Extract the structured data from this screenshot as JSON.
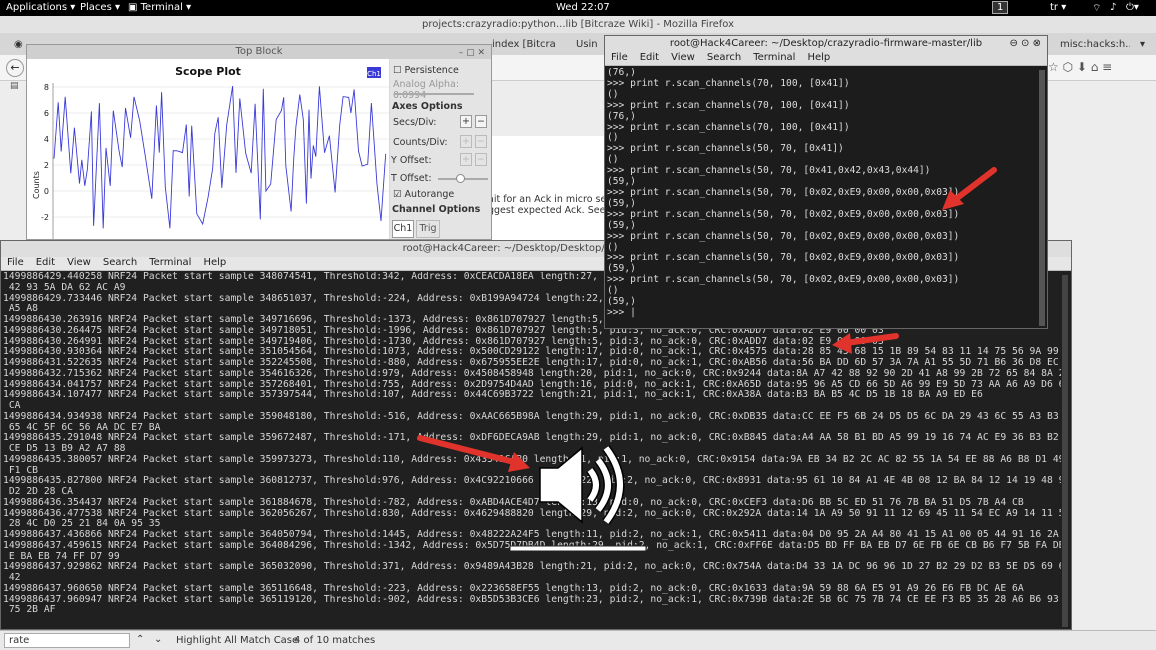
{
  "topbar": {
    "applications": "Applications ▾",
    "places": "Places ▾",
    "terminal": "Terminal ▾",
    "clock": "Wed 22:07",
    "workspace": "1",
    "lang": "tr ▾"
  },
  "firefox": {
    "title": "projects:crazyradio:python...lib [Bitcraze Wiki] - Mozilla Firefox",
    "tabs": [
      "index [Bitcra",
      "Usin",
      "misc:hacks:h..."
    ],
    "wiki_lines": [
      "ait for an Ack in micro second",
      "ggest expected Ack. See nRF"
    ]
  },
  "scope": {
    "window_title": "Top Block",
    "plot_title": "Scope Plot",
    "ch_label": "Ch1",
    "ylabel": "Counts",
    "yticks": [
      "8",
      "6",
      "4",
      "2",
      "0",
      "-2"
    ],
    "persistence": "Persistence",
    "analog_alpha": "Analog Alpha: 0.0994",
    "axes_options": "Axes Options",
    "secs_div": "Secs/Div:",
    "counts_div": "Counts/Div:",
    "y_offset": "Y Offset:",
    "t_offset": "T Offset:",
    "autorange": "Autorange",
    "channel_options": "Channel Options",
    "tab_ch1": "Ch1",
    "tab_trig": "Trig",
    "plus": "+",
    "minus": "−"
  },
  "term2": {
    "title": "root@Hack4Career: ~/Desktop/crazyradio-firmware-master/lib",
    "menu": [
      "File",
      "Edit",
      "View",
      "Search",
      "Terminal",
      "Help"
    ],
    "lines": [
      "(76,)",
      ">>> print r.scan_channels(70, 100, [0x41])",
      "()",
      ">>> print r.scan_channels(70, 100, [0x41])",
      "(76,)",
      ">>> print r.scan_channels(70, 100, [0x41])",
      "()",
      ">>> print r.scan_channels(50, 70, [0x41])",
      "()",
      ">>> print r.scan_channels(50, 70, [0x41,0x42,0x43,0x44])",
      "(59,)",
      ">>> print r.scan_channels(50, 70, [0x02,0xE9,0x00,0x00,0x03])",
      "(59,)",
      ">>> print r.scan_channels(50, 70, [0x02,0xE9,0x00,0x00,0x03])",
      "(59,)",
      ">>> print r.scan_channels(50, 70, [0x02,0xE9,0x00,0x00,0x03])",
      "()",
      ">>> print r.scan_channels(50, 70, [0x02,0xE9,0x00,0x00,0x03])",
      "(59,)",
      ">>> print r.scan_channels(50, 70, [0x02,0xE9,0x00,0x00,0x03])",
      "()",
      "(59,)",
      ">>> |"
    ]
  },
  "term1": {
    "title": "root@Hack4Career: ~/Desktop/Desktop/NRF24-BTLE-",
    "menu": [
      "File",
      "Edit",
      "View",
      "Search",
      "Terminal",
      "Help"
    ],
    "lines": [
      "1499886429.440258 NRF24 Packet start sample 348074541, Threshold:342, Address: 0xCEACDA18EA length:27, pid:1, no",
      " 42 93 5A DA 62 AC A9",
      "1499886429.733446 NRF24 Packet start sample 348651037, Threshold:-224, Address: 0xB199A94724 length:22, pid:3, no",
      " A5 A8",
      "1499886430.263916 NRF24 Packet start sample 349716696, Threshold:-1373, Address: 0x861D707927 length:5, pid:3, no_ack:0, CRC:0xADD7 data:02 E9 00 00 03",
      "1499886430.264475 NRF24 Packet start sample 349718051, Threshold:-1996, Address: 0x861D707927 length:5, pid:3, no_ack:0, CRC:0xADD7 data:02 E9 00 00 03",
      "1499886430.264991 NRF24 Packet start sample 349719406, Threshold:-1730, Address: 0x861D707927 length:5, pid:3, no_ack:0, CRC:0xADD7 data:02 E9 00 00 03",
      "1499886430.930364 NRF24 Packet start sample 351054564, Threshold:1073, Address: 0x500CD29122 length:17, pid:0, no_ack:1, CRC:0x4575 data:28 85 45 68 15 1B 89 54 83 11 14 75 56 9A 99 21",
      "1499886431.522635 NRF24 Packet start sample 352245508, Threshold:-880, Address: 0x675955EE2E length:17, pid:0, no_ack:1, CRC:0xAB56 data:56 BA DD 6D 57 3A 7A A1 55 5D 71 B6 36 D8 EC DF 7E",
      "1499886432.715362 NRF24 Packet start sample 354616326, Threshold:979, Address: 0x4508458948 length:20, pid:1, no_ack:0, CRC:0x9244 data:8A A7 42 88 92 90 2D 41 A8 99 2B 72 65 84 8A 2A 6E 48 8A 11",
      "1499886434.041757 NRF24 Packet start sample 357268401, Threshold:755, Address: 0x2D9754D4AD length:16, pid:0, no_ack:1, CRC:0xA65D data:95 96 A5 CD 66 5D A6 99 E9 5D 73 AA A6 A9 D6 6A",
      "1499886434.107477 NRF24 Packet start sample 357397544, Threshold:107, Address: 0x44C69B3722 length:21, pid:1, no_ack:1, CRC:0xA38A data:B3 BA B5 4C D5 1B 18 BA A9 ED E6",
      " CA",
      "1499886434.934938 NRF24 Packet start sample 359048180, Threshold:-516, Address: 0xAAC665B98A length:29, pid:1, no_ack:0, CRC:0xDB35 data:CC EE F5 6B 24 D5 D5 6C DA 29 43 6C 55 A3 B3 2D 99 D5 B3 BA",
      " 65 4C 5F 6C 56 AA DC E7 BA",
      "1499886435.291048 NRF24 Packet start sample 359672487, Threshold:-171, Address: 0xDF6DECA9AB length:29, pid:1, no_ack:0, CRC:0xB845 data:A4 AA 58 B1 BD A5 99 19 16 74 AC E9 36 B3 B2 BC AB 53 76 7D",
      " CE D5 13 B9 A2 A7 88",
      "1499886435.380057 NRF24 Packet start sample 359973273, Threshold:110, Address: 0x43541CAB0 length:21, pid:1, no_ack:0, CRC:0x9154 data:9A EB 34 B2 2C AC 82 55 1A 54 EE 88 A6 B8 D1 49 4E 94 E5 54",
      " F1 CB",
      "1499886435.827800 NRF24 Packet start sample 360812737, Threshold:976, Address: 0x4C92210666 length:22, pid:2, no_ack:0, CRC:0x8931 data:95 61 10 84 A1 4E 4B 08 12 BA 84 12 14 19 48 90 62 91 89 94",
      " D2 2D 28 CA",
      "1499886436.354437 NRF24 Packet start sample 361884678, Threshold:-782, Address: 0xABD4ACE4D7 length:13, pid:0, no_ack:0, CRC:0xCEF3 data:D6 BB 5C ED 51 76 7B BA 51 D5 7B A4 CB",
      "1499886436.477538 NRF24 Packet start sample 362056267, Threshold:830, Address: 0x4629488820 length:29, pid:2, no_ack:0, CRC:0x292A data:14 1A A9 50 91 11 12 69 45 11 54 EC A9 14 11 50 AC D5 15 41",
      " 28 4C D0 25 21 84 0A 95 35",
      "1499886437.436866 NRF24 Packet start sample 364050794, Threshold:1445, Address: 0x48222A24F5 length:11, pid:2, no_ack:1, CRC:0x5411 data:04 D0 95 2A A4 80 41 15 A1 00 05 44 91 16 2A 41 40",
      "1499886437.459615 NRF24 Packet start sample 364084296, Threshold:-1342, Address: 0x5D75D7DB4D length:29, pid:2, no_ack:1, CRC:0xFF6E data:D5 BD FF BA EB D7 6E FB 6E CB B6 F7 5B FA DB BA F7 5B 56 A",
      " E BA EB 74 FF D7 99",
      "1499886437.929862 NRF24 Packet start sample 365032090, Threshold:371, Address: 0x9489A43B28 length:21, pid:2, no_ack:0, CRC:0x754A data:D4 33 1A DC 96 96 1D 27 B2 29 D2 B3 5E D5 69 65 51 9D AB 08",
      " 42",
      "1499886437.960650 NRF24 Packet start sample 365116648, Threshold:-223, Address: 0x223658EF55 length:13, pid:2, no_ack:0, CRC:0x1633 data:9A 59 88 6A E5 91 A9 26 E6 FB DC AE 6A",
      "1499886437.960947 NRF24 Packet start sample 365119120, Threshold:-902, Address: 0xB5D53B3CE6 length:23, pid:2, no_ack:1, CRC:0x739B data:2E 5B 6C 75 7B 74 CE EE F3 B5 35 28 A6 B6 93 BA DD AE 5A 33",
      " 75 2B AF"
    ]
  },
  "findbar": {
    "query": "rate",
    "highlight_all": "Highlight All",
    "match_case": "Match Case",
    "matches": "4 of 10 matches"
  },
  "icons": {
    "volume": "speaker-volume-icon",
    "arrow": "red-arrow-icon"
  },
  "colors": {
    "accent_red": "#e0332b",
    "plot_line": "#3a3ad8"
  }
}
